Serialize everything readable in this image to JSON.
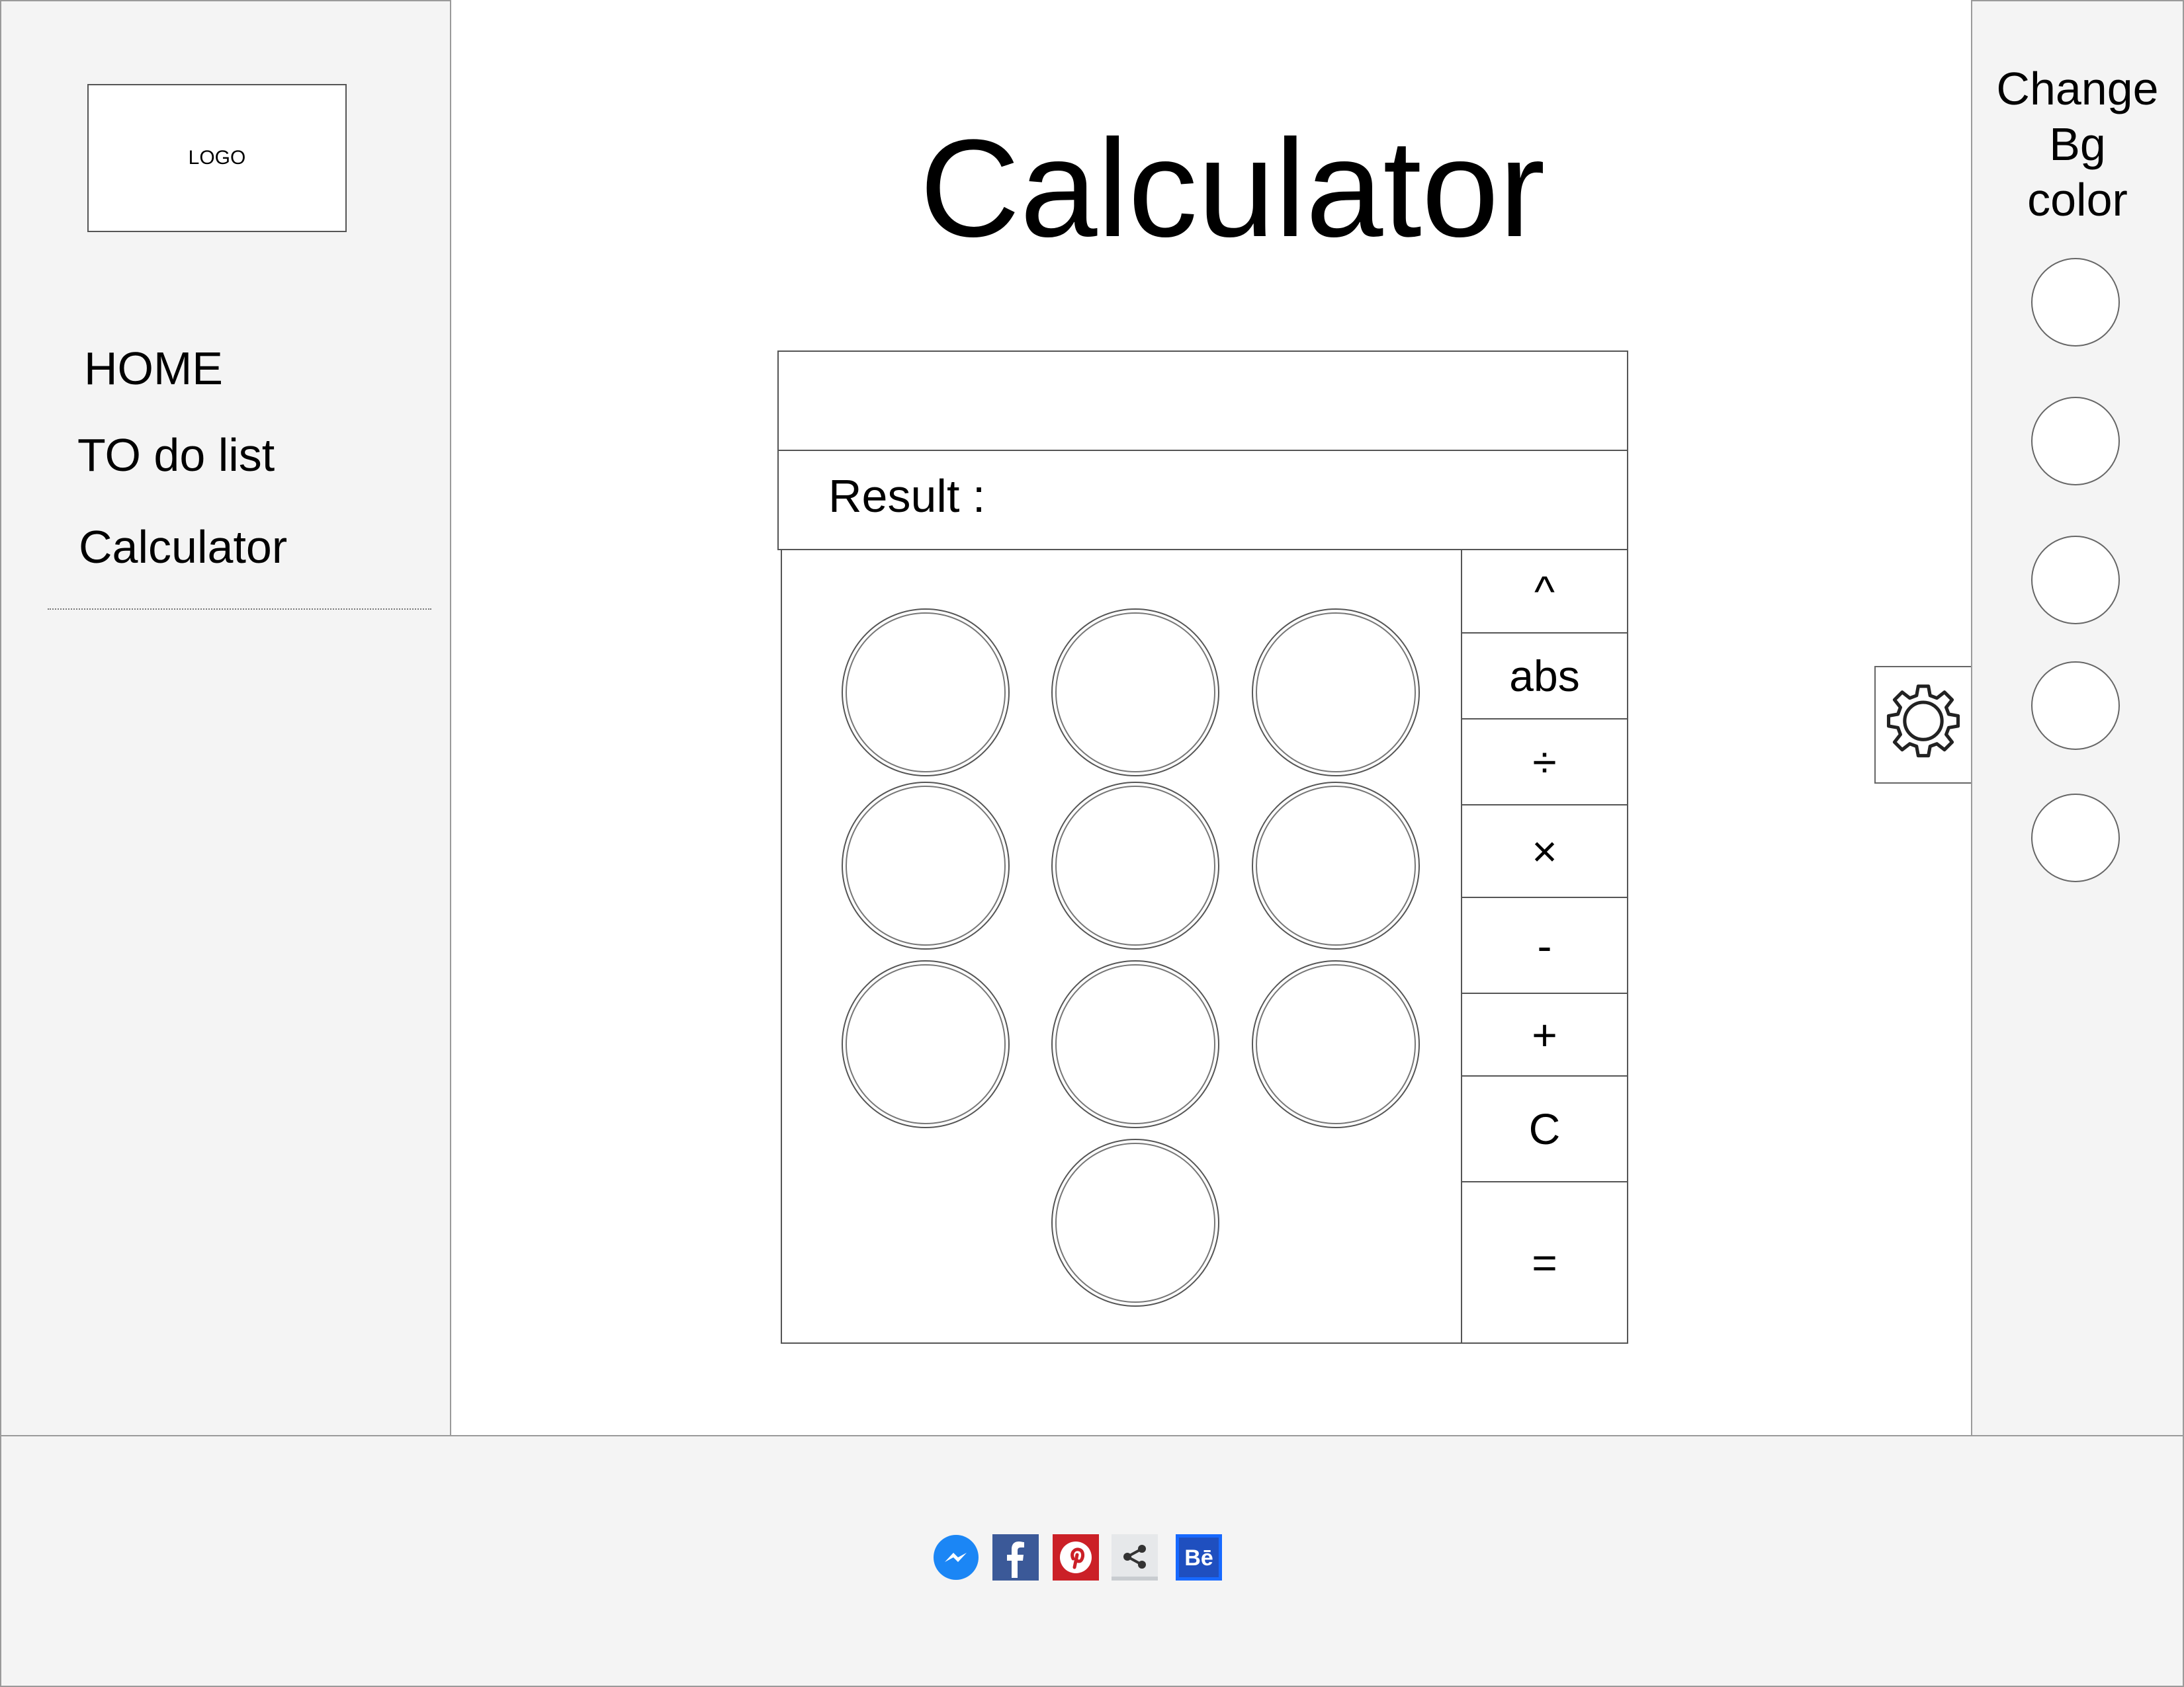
{
  "sidebar": {
    "logo": "LOGO",
    "nav": [
      {
        "label": "HOME"
      },
      {
        "label": "TO do list"
      },
      {
        "label": "Calculator"
      }
    ]
  },
  "main": {
    "title": "Calculator",
    "calculator": {
      "input_value": "",
      "result_label": "Result :",
      "operators": [
        "^",
        "abs",
        "÷",
        "×",
        "-",
        "+",
        "C",
        "="
      ]
    }
  },
  "right_panel": {
    "heading": "Change Bg color",
    "swatch_count": 5
  },
  "footer": {
    "social_icons": [
      "messenger-icon",
      "facebook-icon",
      "pinterest-icon",
      "share-icon",
      "behance-icon"
    ]
  },
  "colors": {
    "panel_bg": "#f4f4f4",
    "messenger": "#1b86f5",
    "facebook": "#3b5998",
    "pinterest": "#cb2027",
    "behance": "#1769ff"
  }
}
